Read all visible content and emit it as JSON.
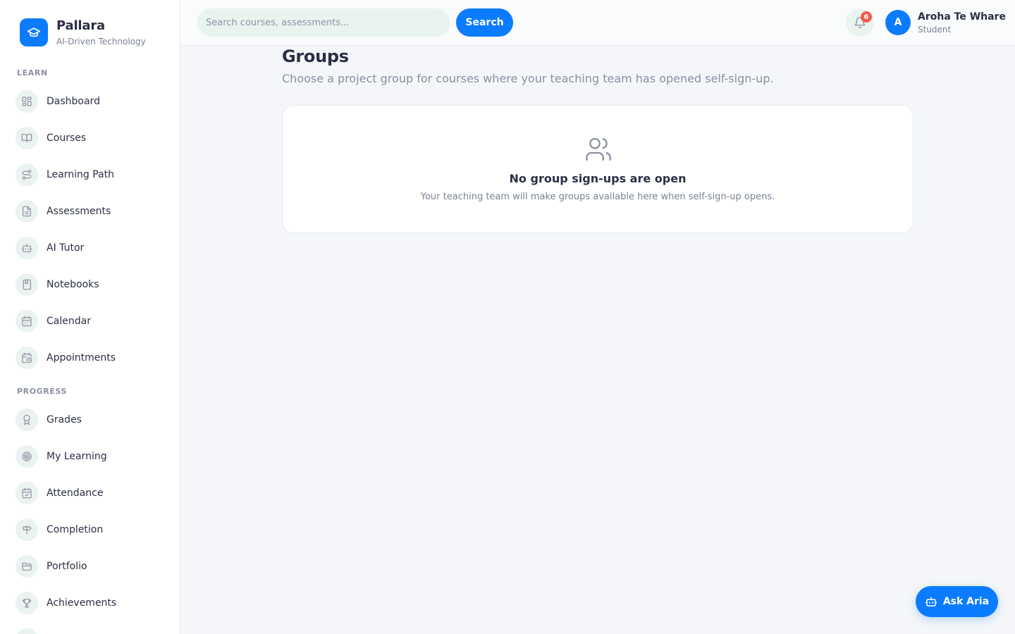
{
  "brand": {
    "name": "Pallara",
    "tagline": "AI-Driven Technology"
  },
  "sidebar": {
    "learn_label": "LEARN",
    "learn_items": [
      {
        "label": "Dashboard",
        "icon": "dashboard-icon"
      },
      {
        "label": "Courses",
        "icon": "book-open-icon"
      },
      {
        "label": "Learning Path",
        "icon": "route-icon"
      },
      {
        "label": "Assessments",
        "icon": "document-icon"
      },
      {
        "label": "AI Tutor",
        "icon": "robot-icon"
      },
      {
        "label": "Notebooks",
        "icon": "notebook-icon"
      },
      {
        "label": "Calendar",
        "icon": "calendar-icon"
      },
      {
        "label": "Appointments",
        "icon": "calendar-clock-icon"
      }
    ],
    "progress_label": "PROGRESS",
    "progress_items": [
      {
        "label": "Grades",
        "icon": "award-icon"
      },
      {
        "label": "My Learning",
        "icon": "target-icon"
      },
      {
        "label": "Attendance",
        "icon": "calendar-check-icon"
      },
      {
        "label": "Completion",
        "icon": "signpost-icon"
      },
      {
        "label": "Portfolio",
        "icon": "folder-icon"
      },
      {
        "label": "Achievements",
        "icon": "trophy-icon"
      }
    ]
  },
  "topbar": {
    "search_placeholder": "Search courses, assessments...",
    "search_value": "",
    "search_button": "Search",
    "notification_count": "6",
    "user": {
      "initial": "A",
      "name": "Aroha Te Whare",
      "role": "Student"
    }
  },
  "main": {
    "title": "Groups",
    "subtitle": "Choose a project group for courses where your teaching team has opened self-sign-up.",
    "empty_state": {
      "icon": "users-icon",
      "title": "No group sign-ups are open",
      "text": "Your teaching team will make groups available here when self-sign-up opens."
    }
  },
  "assistant_button": {
    "label": "Ask Aria",
    "icon": "robot-icon"
  },
  "colors": {
    "accent": "#0b7cff",
    "badge": "#f25a4a",
    "icon_bg": "#eaf3ef",
    "page_bg": "#f4f6f9"
  }
}
